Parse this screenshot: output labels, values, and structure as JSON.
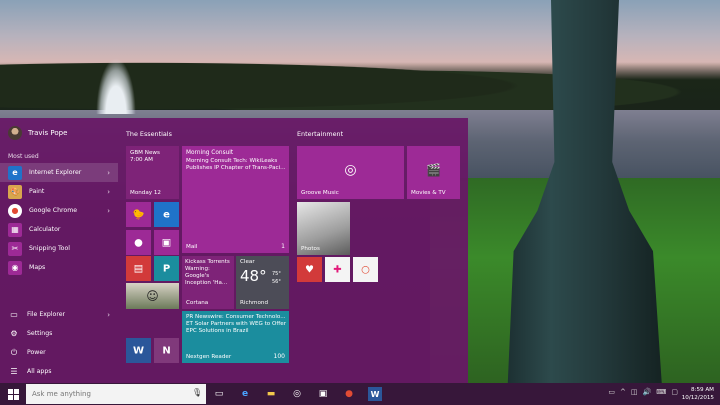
{
  "user": {
    "name": "Travis Pope"
  },
  "left": {
    "most_used_label": "Most used",
    "items": [
      {
        "label": "Internet Explorer",
        "icon": "internet-explorer-icon",
        "glyph": "e",
        "color": "#1f73c9",
        "chevron": "›"
      },
      {
        "label": "Paint",
        "icon": "paint-icon",
        "glyph": "🎨",
        "color": "#d8a64e",
        "chevron": "›"
      },
      {
        "label": "Google Chrome",
        "icon": "chrome-icon",
        "glyph": "●",
        "color": "#e24b34",
        "chevron": "›"
      },
      {
        "label": "Calculator",
        "icon": "calculator-icon",
        "glyph": "▦",
        "color": "#9d2a96",
        "chevron": ""
      },
      {
        "label": "Snipping Tool",
        "icon": "scissors-icon",
        "glyph": "✂",
        "color": "#9d2a96",
        "chevron": ""
      },
      {
        "label": "Maps",
        "icon": "maps-icon",
        "glyph": "◉",
        "color": "#9d2a96",
        "chevron": ""
      }
    ],
    "bottom": [
      {
        "label": "File Explorer",
        "icon": "folder-icon",
        "glyph": "▭",
        "chevron": "›"
      },
      {
        "label": "Settings",
        "icon": "gear-icon",
        "glyph": "⚙",
        "chevron": ""
      },
      {
        "label": "Power",
        "icon": "power-icon",
        "glyph": "⏻",
        "chevron": ""
      },
      {
        "label": "All apps",
        "icon": "all-apps-icon",
        "glyph": "☰",
        "chevron": ""
      }
    ]
  },
  "groups": {
    "essentials": "The Essentials",
    "entertainment": "Entertainment"
  },
  "tiles": {
    "gbm": {
      "title": "GBM News",
      "time": "7:00 AM",
      "date": "Monday 12"
    },
    "morning": {
      "title": "Morning Consult",
      "body": "Morning Consult Tech: WikiLeaks Publishes IP Chapter of Trans-Paci...",
      "name": "Mail",
      "badge": "1"
    },
    "kickass": {
      "title": "Kickass Torrents",
      "body": "Warning: Google's Inception 'Ha...",
      "name": "Cortana"
    },
    "weather": {
      "cond": "Clear",
      "temp": "48°",
      "hi": "75°",
      "lo": "56°",
      "name": "Richmond"
    },
    "photos": {
      "name": "Photos"
    },
    "news": {
      "title": "PR Newswire: Consumer Technolo...",
      "body": "ET Solar Partners with WEG to Offer EPC Solutions in Brazil",
      "name": "Nextgen Reader",
      "badge": "100"
    },
    "groove": {
      "name": "Groove Music"
    },
    "movies": {
      "name": "Movies & TV"
    }
  },
  "taskbar": {
    "search_placeholder": "Ask me anything",
    "time": "8:59 AM",
    "date": "10/12/2015"
  }
}
